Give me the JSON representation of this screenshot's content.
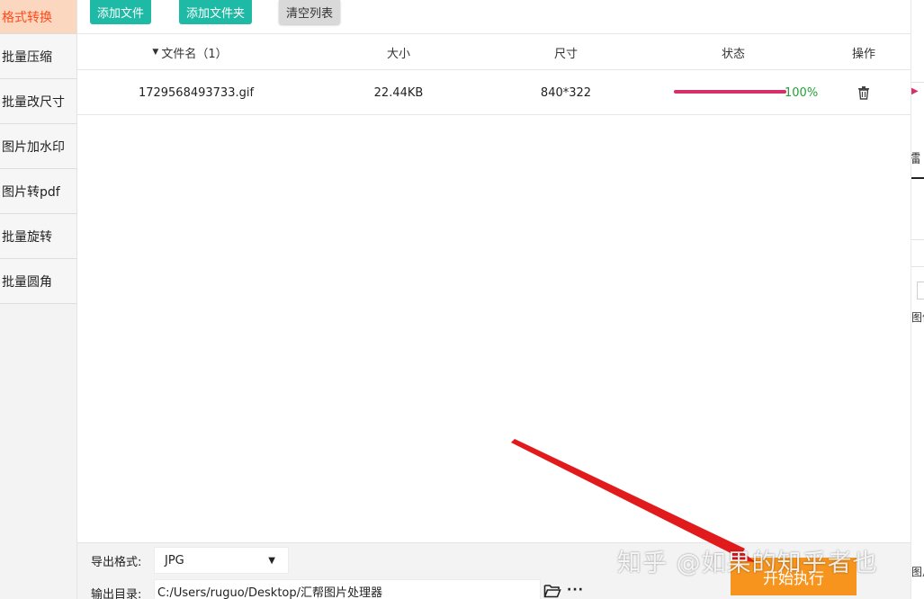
{
  "sidebar": {
    "items": [
      {
        "label": "格式转换",
        "active": true
      },
      {
        "label": "批量压缩",
        "active": false
      },
      {
        "label": "批量改尺寸",
        "active": false
      },
      {
        "label": "图片加水印",
        "active": false
      },
      {
        "label": "图片转pdf",
        "active": false
      },
      {
        "label": "批量旋转",
        "active": false
      },
      {
        "label": "批量圆角",
        "active": false
      }
    ]
  },
  "toolbar": {
    "add_file_label": "添加文件",
    "add_folder_label": "添加文件夹",
    "clear_list_label": "清空列表"
  },
  "table": {
    "columns": {
      "filename": "文件名（1）",
      "size": "大小",
      "dimensions": "尺寸",
      "status": "状态",
      "actions": "操作"
    },
    "rows": [
      {
        "filename": "1729568493733.gif",
        "size": "22.44KB",
        "dimensions": "840*322",
        "progress": 1.0,
        "status": "100%"
      }
    ]
  },
  "settings": {
    "format_label": "导出格式:",
    "format_value": "JPG",
    "output_label": "输出目录:",
    "output_path": "C:/Users/ruguo/Desktop/汇帮图片处理器",
    "more_label": "···",
    "start_label": "开始执行"
  },
  "right_panel": {
    "tab_fragment": "擂",
    "label_fragment_1": "图像",
    "label_fragment_2": "图片"
  },
  "watermark": "知乎 @如果的知乎者也",
  "colors": {
    "teal": "#1fbaa5",
    "orange": "#f7941d",
    "active_bg": "#fbd7bf",
    "active_text": "#ff4a1a",
    "progress": "#d6306b",
    "percent": "#23a23a"
  }
}
